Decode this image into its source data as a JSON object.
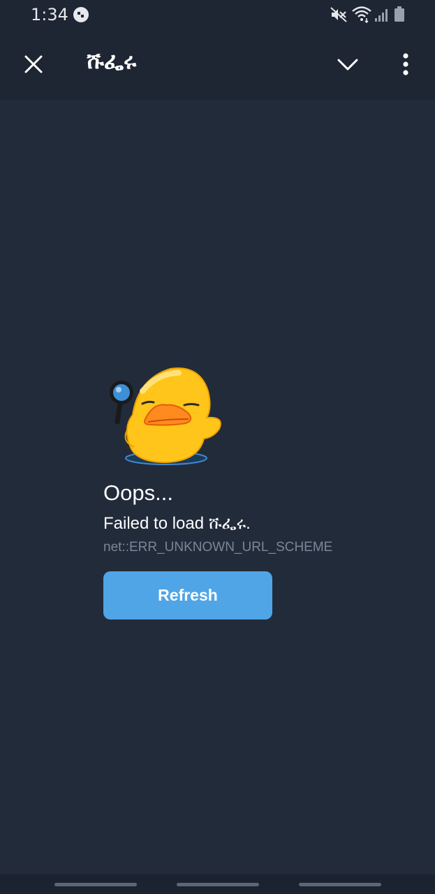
{
  "status_bar": {
    "time": "1:34",
    "icons": [
      "app-notification-icon",
      "mute-icon",
      "wifi-icon",
      "signal-icon",
      "battery-icon"
    ]
  },
  "header": {
    "title": "ሹፌሩ",
    "close_icon": "close-icon",
    "collapse_icon": "chevron-down-icon",
    "menu_icon": "more-vertical-icon"
  },
  "error": {
    "sticker": "duck-with-magnifier-sticker",
    "heading": "Oops...",
    "message": "Failed to load ሹፌሩ.",
    "code": "net::ERR_UNKNOWN_URL_SCHEME",
    "refresh_label": "Refresh"
  },
  "colors": {
    "background": "#222b3a",
    "header": "#1e2533",
    "accent": "#50a5e6",
    "muted_text": "#7c8696"
  }
}
